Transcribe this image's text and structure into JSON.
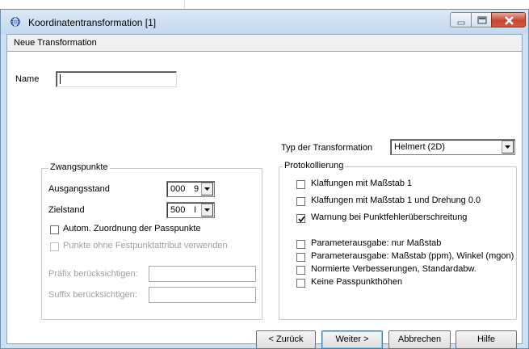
{
  "window": {
    "title": "Koordinatentransformation [1]"
  },
  "header": {
    "title": "Neue Transformation"
  },
  "name_field": {
    "label": "Name",
    "value": ""
  },
  "transform_type": {
    "label": "Typ der Transformation",
    "value": "Helmert (2D)"
  },
  "zwangspunkte": {
    "legend": "Zwangspunkte",
    "ausgangsstand_label": "Ausgangsstand",
    "ausgangsstand_value": "000",
    "ausgangsstand_partial": "9",
    "zielstand_label": "Zielstand",
    "zielstand_value": "500",
    "zielstand_partial": "I",
    "auto_zuordnung": {
      "label": "Autom. Zuordnung der Passpunkte",
      "checked": false,
      "enabled": true
    },
    "ohne_festpunkt": {
      "label": "Punkte ohne Festpunktattribut verwenden",
      "checked": false,
      "enabled": false
    },
    "praefix_label": "Präfix berücksichtigen:",
    "praefix_value": "",
    "suffix_label": "Suffix berücksichtigen:",
    "suffix_value": ""
  },
  "protokoll": {
    "legend": "Protokollierung",
    "items": [
      {
        "label": "Klaffungen mit Maßstab 1",
        "checked": false
      },
      {
        "label": "Klaffungen mit Maßstab 1 und Drehung 0.0",
        "checked": false
      },
      {
        "label": "Warnung bei Punktfehlerüberschreitung",
        "checked": true
      },
      {
        "label": "Parameterausgabe: nur Maßstab",
        "checked": false
      },
      {
        "label": "Parameterausgabe: Maßstab (ppm), Winkel (mgon)",
        "checked": false
      },
      {
        "label": "Normierte Verbesserungen, Standardabw.",
        "checked": false
      },
      {
        "label": "Keine Passpunkthöhen",
        "checked": false
      }
    ]
  },
  "buttons": {
    "back": "< Zurück",
    "next": "Weiter >",
    "cancel": "Abbrechen",
    "help": "Hilfe"
  },
  "colors": {
    "titlebar": "#c4d8ee",
    "close": "#c8452f",
    "header_bg": "#f0f0f0"
  }
}
